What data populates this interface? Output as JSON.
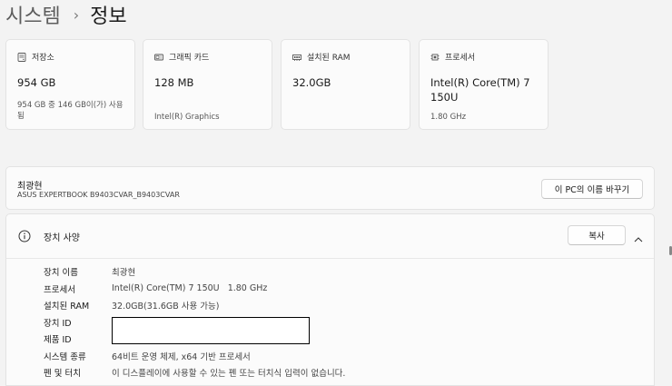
{
  "breadcrumb": {
    "parent": "시스템",
    "separator": "›",
    "current": "정보"
  },
  "cards": [
    {
      "icon": "storage-icon",
      "title": "저장소",
      "value": "954 GB",
      "sub": "954 GB 중 146 GB이(가) 사용됨"
    },
    {
      "icon": "graphics-card-icon",
      "title": "그래픽 카드",
      "value": "128 MB",
      "sub": "Intel(R) Graphics"
    },
    {
      "icon": "ram-icon",
      "title": "설치된 RAM",
      "value": "32.0GB",
      "sub": ""
    },
    {
      "icon": "processor-icon",
      "title": "프로세서",
      "value": "Intel(R) Core(TM) 7 150U",
      "sub": "1.80 GHz"
    }
  ],
  "device": {
    "name": "최광현",
    "model": "ASUS EXPERTBOOK B9403CVAR_B9403CVAR",
    "rename_label": "이 PC의 이름 바꾸기"
  },
  "specs": {
    "title": "장치 사양",
    "copy_label": "복사",
    "rows": [
      {
        "label": "장치 이름",
        "value": "최광현"
      },
      {
        "label": "프로세서",
        "value": "Intel(R) Core(TM) 7 150U   1.80 GHz"
      },
      {
        "label": "설치된 RAM",
        "value": "32.0GB(31.6GB 사용 가능)"
      },
      {
        "label": "장치 ID",
        "value": ""
      },
      {
        "label": "제품 ID",
        "value": ""
      },
      {
        "label": "시스템 종류",
        "value": "64비트 운영 체제, x64 기반 프로세서"
      },
      {
        "label": "펜 및 터치",
        "value": "이 디스플레이에 사용할 수 있는 펜 또는 터치식 입력이 없습니다."
      }
    ]
  }
}
